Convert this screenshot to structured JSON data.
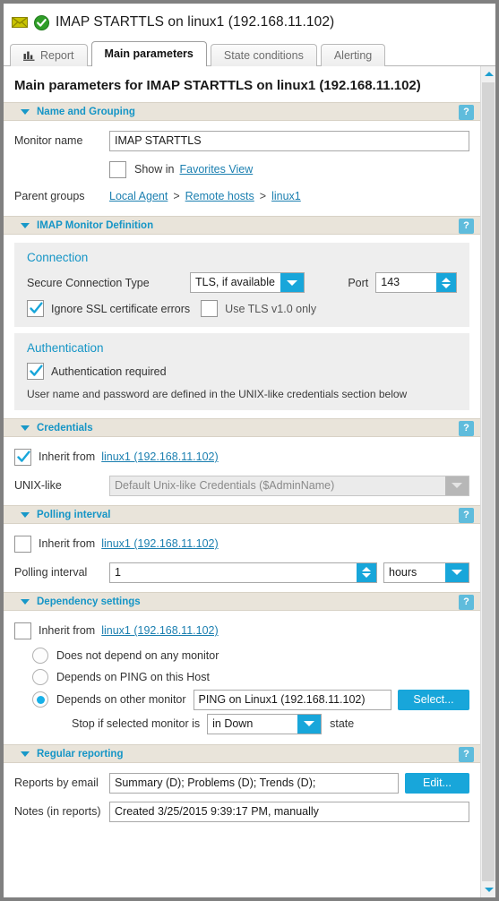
{
  "window": {
    "title": "IMAP STARTTLS on linux1  (192.168.11.102)",
    "status_icon": "mail-envelope-icon",
    "state_icon": "green-check-circle-icon"
  },
  "tabs": [
    {
      "label": "Report",
      "icon": "bar-chart-icon",
      "active": false
    },
    {
      "label": "Main parameters",
      "icon": "",
      "active": true
    },
    {
      "label": "State conditions",
      "icon": "",
      "active": false
    },
    {
      "label": "Alerting",
      "icon": "",
      "active": false
    }
  ],
  "page_heading": "Main parameters for IMAP STARTTLS on linux1  (192.168.11.102)",
  "help_label": "?",
  "sections": {
    "name_and_grouping": {
      "title": "Name and Grouping",
      "monitor_name_label": "Monitor name",
      "monitor_name_value": "IMAP STARTTLS",
      "show_in_label": "Show in",
      "favorites_view_link": "Favorites View",
      "show_in_checked": false,
      "parent_groups_label": "Parent groups",
      "parent_groups": [
        "Local Agent",
        "Remote hosts",
        "linux1"
      ],
      "breadcrumb_separator": ">"
    },
    "imap_monitor_definition": {
      "title": "IMAP Monitor Definition",
      "connection": {
        "panel_title": "Connection",
        "secure_connection_type_label": "Secure Connection Type",
        "secure_connection_type_value": "TLS, if available",
        "port_label": "Port",
        "port_value": "143",
        "ignore_ssl_label": "Ignore SSL certificate errors",
        "ignore_ssl_checked": true,
        "use_tls10_label": "Use TLS v1.0 only",
        "use_tls10_checked": false
      },
      "authentication": {
        "panel_title": "Authentication",
        "auth_required_label": "Authentication required",
        "auth_required_checked": true,
        "note": "User name and password are defined in the UNIX-like credentials section below"
      }
    },
    "credentials": {
      "title": "Credentials",
      "inherit_label": "Inherit from",
      "inherit_link": "linux1 (192.168.11.102)",
      "inherit_checked": true,
      "unix_like_label": "UNIX-like",
      "unix_like_value": "Default Unix-like Credentials ($AdminName)",
      "unix_like_disabled": true
    },
    "polling_interval": {
      "title": "Polling interval",
      "inherit_label": "Inherit from",
      "inherit_link": "linux1 (192.168.11.102)",
      "inherit_checked": false,
      "interval_label": "Polling interval",
      "interval_value": "1",
      "interval_units": "hours"
    },
    "dependency_settings": {
      "title": "Dependency settings",
      "inherit_label": "Inherit from",
      "inherit_link": "linux1 (192.168.11.102)",
      "inherit_checked": false,
      "options": [
        {
          "label": "Does not depend on any monitor",
          "selected": false
        },
        {
          "label": "Depends on PING on this Host",
          "selected": false
        },
        {
          "label": "Depends on other monitor",
          "selected": true
        }
      ],
      "other_monitor_value": "PING on Linux1 (192.168.11.102)",
      "select_button": "Select...",
      "stop_if_label": "Stop if selected monitor is",
      "stop_if_value": "in Down",
      "state_label": "state"
    },
    "regular_reporting": {
      "title": "Regular reporting",
      "reports_label": "Reports by email",
      "reports_value": "Summary (D); Problems (D); Trends (D);",
      "edit_button": "Edit...",
      "notes_label": "Notes (in reports)",
      "notes_value": "Created 3/25/2015 9:39:17 PM, manually"
    }
  },
  "colors": {
    "accent": "#18a6da",
    "link": "#1b7fb0",
    "section_header_bg": "#e9e4da",
    "section_title": "#1595c6",
    "ok_green": "#2f9e28",
    "envelope": "#a8a000"
  }
}
